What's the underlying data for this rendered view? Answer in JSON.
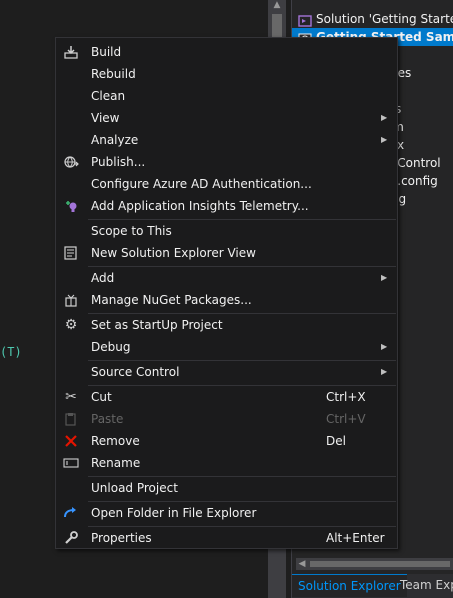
{
  "editor": {
    "code_fragment": "(T)"
  },
  "solution_explorer": {
    "rows": [
      {
        "label": "Solution 'Getting Started"
      },
      {
        "label": "Getting Started Sam"
      },
      {
        "label": "ties"
      },
      {
        "label": "ences"
      },
      {
        "label": "art"
      },
      {
        "label": "llers"
      },
      {
        "label": ".htm"
      },
      {
        "label": "asax"
      },
      {
        "label": "gesControl"
      },
      {
        "label": "ges.config"
      },
      {
        "label": "onfig"
      }
    ],
    "tabs": [
      "Solution Explorer",
      "Team Explo"
    ]
  },
  "menu": {
    "items": [
      {
        "label": "Build",
        "icon": "build-icon"
      },
      {
        "label": "Rebuild"
      },
      {
        "label": "Clean"
      },
      {
        "label": "View",
        "submenu": "▶"
      },
      {
        "label": "Analyze",
        "submenu": "▶"
      },
      {
        "label": "Publish...",
        "icon": "publish-globe-icon"
      },
      {
        "label": "Configure Azure AD Authentication..."
      },
      {
        "label": "Add Application Insights Telemetry...",
        "icon": "app-insights-icon"
      },
      {
        "label": "Scope to This"
      },
      {
        "label": "New Solution Explorer View",
        "icon": "new-view-icon"
      },
      {
        "label": "Add",
        "submenu": "▶"
      },
      {
        "label": "Manage NuGet Packages...",
        "icon": "nuget-icon"
      },
      {
        "label": "Set as StartUp Project",
        "icon": "gear-icon"
      },
      {
        "label": "Debug",
        "submenu": "▶"
      },
      {
        "label": "Source Control",
        "submenu": "▶"
      },
      {
        "label": "Cut",
        "shortcut": "Ctrl+X",
        "icon": "scissors-icon"
      },
      {
        "label": "Paste",
        "shortcut": "Ctrl+V",
        "icon": "paste-icon",
        "disabled": true
      },
      {
        "label": "Remove",
        "shortcut": "Del",
        "icon": "remove-x-icon"
      },
      {
        "label": "Rename",
        "icon": "rename-icon"
      },
      {
        "label": "Unload Project"
      },
      {
        "label": "Open Folder in File Explorer",
        "icon": "open-folder-arrow-icon"
      },
      {
        "label": "Properties",
        "shortcut": "Alt+Enter",
        "icon": "wrench-icon"
      }
    ]
  },
  "colors": {
    "menu_bg": "#1b1b1c",
    "menu_text": "#f1f1f1",
    "disabled_text": "#656565",
    "selection": "#007acc",
    "remove_icon": "#e51400",
    "open_folder_icon": "#3794ff",
    "code_fragment": "#4ec9b0"
  }
}
